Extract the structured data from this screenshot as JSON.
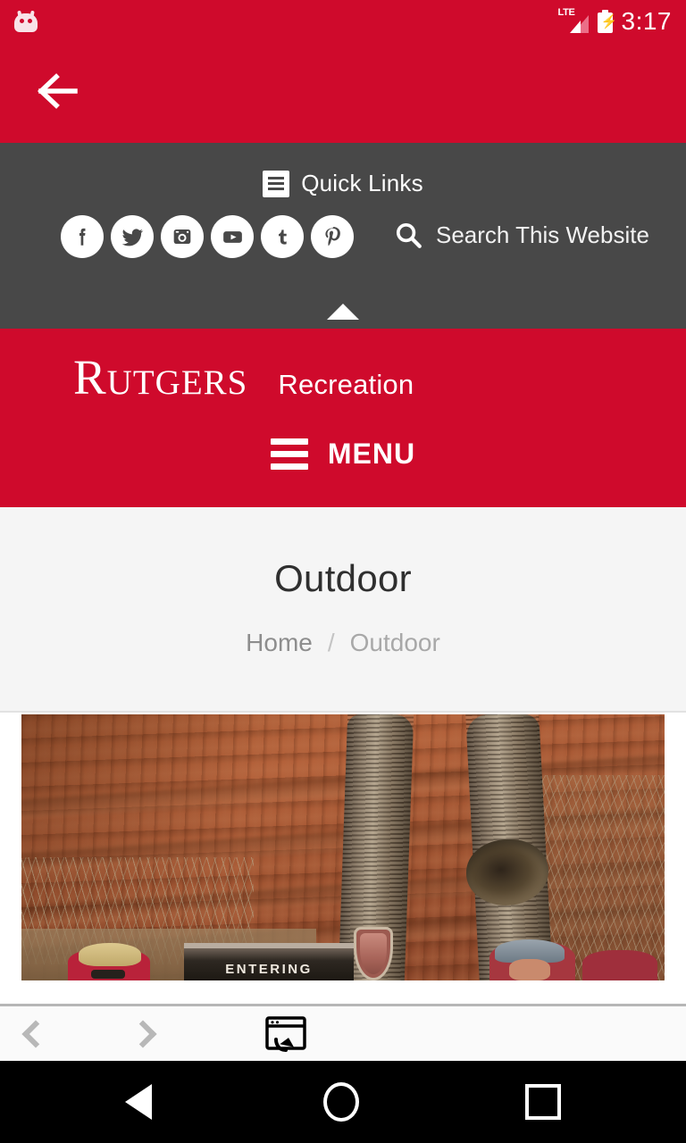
{
  "status_bar": {
    "notification_icon": "android-head-icon",
    "network_type": "LTE",
    "signal_icon": "signal-bars-icon",
    "battery_icon": "battery-charging-icon",
    "time": "3:17",
    "background_color": "#cf0a2c"
  },
  "app_bar": {
    "back_icon": "back-arrow-icon",
    "background_color": "#cf0a2c"
  },
  "quick_links_panel": {
    "background_color": "#484848",
    "quick_links_label": "Quick Links",
    "quick_links_icon": "list-menu-icon",
    "social_icons": [
      {
        "name": "facebook-icon",
        "label": "Facebook"
      },
      {
        "name": "twitter-icon",
        "label": "Twitter"
      },
      {
        "name": "instagram-icon",
        "label": "Instagram"
      },
      {
        "name": "youtube-icon",
        "label": "YouTube"
      },
      {
        "name": "tumblr-icon",
        "label": "Tumblr"
      },
      {
        "name": "pinterest-icon",
        "label": "Pinterest"
      }
    ],
    "search_icon": "search-icon",
    "search_label": "Search This Website",
    "collapse_icon": "caret-up-icon"
  },
  "brand_header": {
    "background_color": "#cf0a2c",
    "wordmark": "Rutgers",
    "unit": "Recreation",
    "menu_icon": "hamburger-icon",
    "menu_label": "MENU"
  },
  "page": {
    "title": "Outdoor",
    "breadcrumb": {
      "home": "Home",
      "separator": "/",
      "current": "Outdoor"
    },
    "hero_image": {
      "name": "canyon-photo",
      "sign_text": "ENTERING",
      "arrowhead_icon": "nps-arrowhead-icon"
    }
  },
  "browser_toolbar": {
    "back_icon": "chevron-left-icon",
    "forward_icon": "chevron-right-icon",
    "open_in_browser_icon": "open-in-browser-icon"
  },
  "android_nav": {
    "back_icon": "nav-back-triangle-icon",
    "home_icon": "nav-home-circle-icon",
    "recents_icon": "nav-recents-square-icon"
  }
}
